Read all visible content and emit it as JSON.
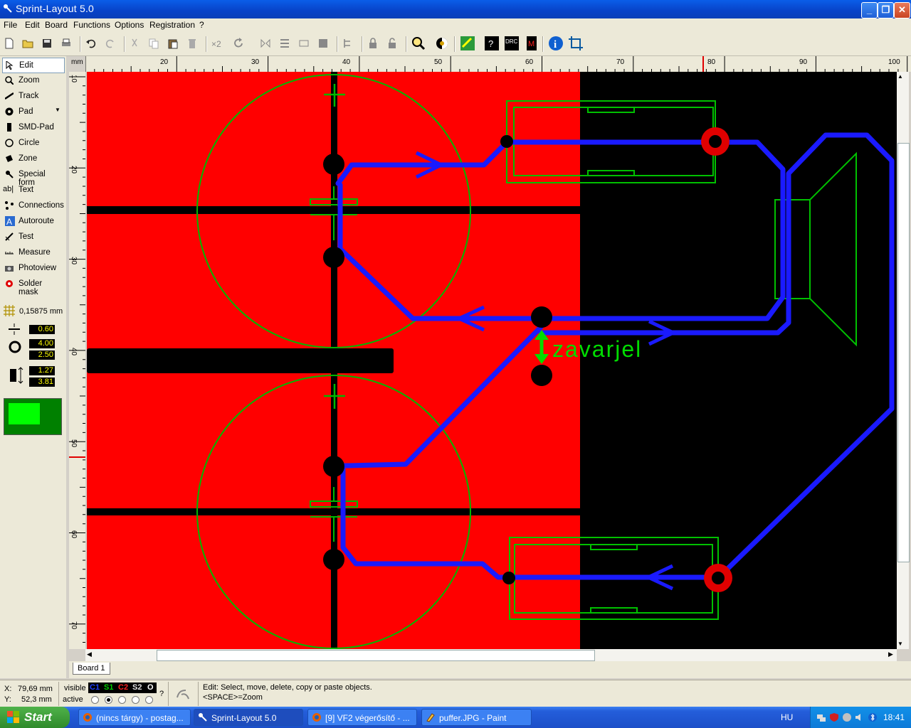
{
  "window": {
    "title": "Sprint-Layout 5.0"
  },
  "menu": [
    "File",
    "Edit",
    "Board",
    "Functions",
    "Options",
    "Registration",
    "?"
  ],
  "tools": [
    {
      "label": "Edit",
      "icon": "arrow-cursor-icon"
    },
    {
      "label": "Zoom",
      "icon": "magnifier-icon"
    },
    {
      "label": "Track",
      "icon": "track-icon"
    },
    {
      "label": "Pad",
      "icon": "pad-icon"
    },
    {
      "label": "SMD-Pad",
      "icon": "smd-pad-icon"
    },
    {
      "label": "Circle",
      "icon": "circle-icon"
    },
    {
      "label": "Zone",
      "icon": "zone-icon"
    },
    {
      "label": "Special form",
      "icon": "special-form-icon"
    },
    {
      "label": "Text",
      "icon": "text-icon"
    },
    {
      "label": "Connections",
      "icon": "connections-icon"
    },
    {
      "label": "Autoroute",
      "icon": "autoroute-icon"
    },
    {
      "label": "Test",
      "icon": "test-icon"
    },
    {
      "label": "Measure",
      "icon": "measure-icon"
    },
    {
      "label": "Photoview",
      "icon": "camera-icon"
    },
    {
      "label": "Solder mask",
      "icon": "solder-mask-icon"
    }
  ],
  "grid": {
    "value": "0,15875 mm"
  },
  "params": {
    "track_width": "0.60",
    "pad_outer": "4.00",
    "pad_inner": "2.50",
    "smd_w": "1.27",
    "smd_h": "3.81"
  },
  "ruler": {
    "unit": "mm",
    "top": [
      "20",
      "30",
      "40",
      "50",
      "60",
      "70",
      "80",
      "90",
      "100"
    ],
    "left": [
      "10",
      "20",
      "30",
      "40",
      "50",
      "60",
      "70"
    ]
  },
  "board": {
    "text": "zavarjel",
    "tab": "Board 1"
  },
  "colors": {
    "copper_bottom": "#ff0000",
    "track": "#1a1aff",
    "silk": "#00cc00",
    "background": "#000000"
  },
  "status": {
    "x_label": "X:",
    "x_value": "79,69 mm",
    "y_label": "Y:",
    "y_value": "52,3 mm",
    "visible_label": "visible",
    "active_label": "active",
    "layers": [
      "C1",
      "S1",
      "C2",
      "S2",
      "O"
    ],
    "help_line1": "Edit: Select, move, delete, copy or paste objects.",
    "help_line2": "<SPACE>=Zoom",
    "question": "?"
  },
  "taskbar": {
    "start": "Start",
    "tasks": [
      "(nincs tárgy) - postag...",
      "Sprint-Layout 5.0",
      "[9] VF2 végerősítő - ...",
      "puffer.JPG - Paint"
    ],
    "lang": "HU",
    "time": "18:41"
  }
}
